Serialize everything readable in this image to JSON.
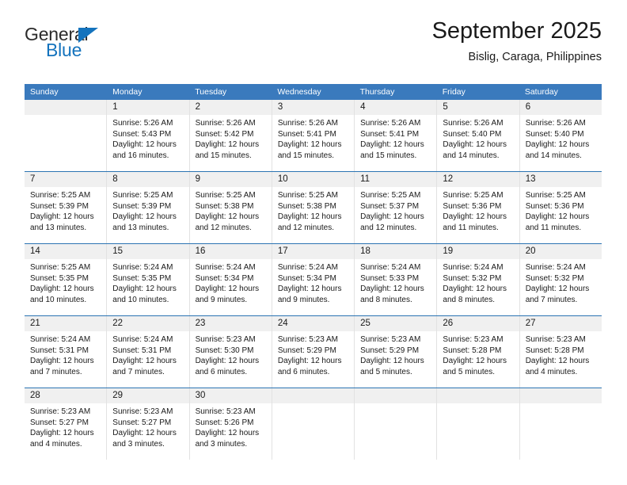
{
  "logo": {
    "text_primary": "General",
    "text_secondary": "Blue",
    "triangle_color": "#1473bd",
    "primary_color": "#2b2b2b",
    "secondary_color": "#1473bd",
    "icon": "triangle-right-icon"
  },
  "header": {
    "title": "September 2025",
    "subtitle": "Bislig, Caraga, Philippines"
  },
  "theme": {
    "header_bg": "#3a7abd",
    "header_text": "#ffffff",
    "row_divider": "#2c74b3",
    "daynum_bg": "#f0f0f0",
    "cell_divider": "#e2e2e2"
  },
  "calendar": {
    "weekdays": [
      "Sunday",
      "Monday",
      "Tuesday",
      "Wednesday",
      "Thursday",
      "Friday",
      "Saturday"
    ],
    "weeks": [
      [
        {
          "day": "",
          "sunrise": "",
          "sunset": "",
          "daylight_line1": "",
          "daylight_line2": ""
        },
        {
          "day": "1",
          "sunrise": "Sunrise: 5:26 AM",
          "sunset": "Sunset: 5:43 PM",
          "daylight_line1": "Daylight: 12 hours",
          "daylight_line2": "and 16 minutes."
        },
        {
          "day": "2",
          "sunrise": "Sunrise: 5:26 AM",
          "sunset": "Sunset: 5:42 PM",
          "daylight_line1": "Daylight: 12 hours",
          "daylight_line2": "and 15 minutes."
        },
        {
          "day": "3",
          "sunrise": "Sunrise: 5:26 AM",
          "sunset": "Sunset: 5:41 PM",
          "daylight_line1": "Daylight: 12 hours",
          "daylight_line2": "and 15 minutes."
        },
        {
          "day": "4",
          "sunrise": "Sunrise: 5:26 AM",
          "sunset": "Sunset: 5:41 PM",
          "daylight_line1": "Daylight: 12 hours",
          "daylight_line2": "and 15 minutes."
        },
        {
          "day": "5",
          "sunrise": "Sunrise: 5:26 AM",
          "sunset": "Sunset: 5:40 PM",
          "daylight_line1": "Daylight: 12 hours",
          "daylight_line2": "and 14 minutes."
        },
        {
          "day": "6",
          "sunrise": "Sunrise: 5:26 AM",
          "sunset": "Sunset: 5:40 PM",
          "daylight_line1": "Daylight: 12 hours",
          "daylight_line2": "and 14 minutes."
        }
      ],
      [
        {
          "day": "7",
          "sunrise": "Sunrise: 5:25 AM",
          "sunset": "Sunset: 5:39 PM",
          "daylight_line1": "Daylight: 12 hours",
          "daylight_line2": "and 13 minutes."
        },
        {
          "day": "8",
          "sunrise": "Sunrise: 5:25 AM",
          "sunset": "Sunset: 5:39 PM",
          "daylight_line1": "Daylight: 12 hours",
          "daylight_line2": "and 13 minutes."
        },
        {
          "day": "9",
          "sunrise": "Sunrise: 5:25 AM",
          "sunset": "Sunset: 5:38 PM",
          "daylight_line1": "Daylight: 12 hours",
          "daylight_line2": "and 12 minutes."
        },
        {
          "day": "10",
          "sunrise": "Sunrise: 5:25 AM",
          "sunset": "Sunset: 5:38 PM",
          "daylight_line1": "Daylight: 12 hours",
          "daylight_line2": "and 12 minutes."
        },
        {
          "day": "11",
          "sunrise": "Sunrise: 5:25 AM",
          "sunset": "Sunset: 5:37 PM",
          "daylight_line1": "Daylight: 12 hours",
          "daylight_line2": "and 12 minutes."
        },
        {
          "day": "12",
          "sunrise": "Sunrise: 5:25 AM",
          "sunset": "Sunset: 5:36 PM",
          "daylight_line1": "Daylight: 12 hours",
          "daylight_line2": "and 11 minutes."
        },
        {
          "day": "13",
          "sunrise": "Sunrise: 5:25 AM",
          "sunset": "Sunset: 5:36 PM",
          "daylight_line1": "Daylight: 12 hours",
          "daylight_line2": "and 11 minutes."
        }
      ],
      [
        {
          "day": "14",
          "sunrise": "Sunrise: 5:25 AM",
          "sunset": "Sunset: 5:35 PM",
          "daylight_line1": "Daylight: 12 hours",
          "daylight_line2": "and 10 minutes."
        },
        {
          "day": "15",
          "sunrise": "Sunrise: 5:24 AM",
          "sunset": "Sunset: 5:35 PM",
          "daylight_line1": "Daylight: 12 hours",
          "daylight_line2": "and 10 minutes."
        },
        {
          "day": "16",
          "sunrise": "Sunrise: 5:24 AM",
          "sunset": "Sunset: 5:34 PM",
          "daylight_line1": "Daylight: 12 hours",
          "daylight_line2": "and 9 minutes."
        },
        {
          "day": "17",
          "sunrise": "Sunrise: 5:24 AM",
          "sunset": "Sunset: 5:34 PM",
          "daylight_line1": "Daylight: 12 hours",
          "daylight_line2": "and 9 minutes."
        },
        {
          "day": "18",
          "sunrise": "Sunrise: 5:24 AM",
          "sunset": "Sunset: 5:33 PM",
          "daylight_line1": "Daylight: 12 hours",
          "daylight_line2": "and 8 minutes."
        },
        {
          "day": "19",
          "sunrise": "Sunrise: 5:24 AM",
          "sunset": "Sunset: 5:32 PM",
          "daylight_line1": "Daylight: 12 hours",
          "daylight_line2": "and 8 minutes."
        },
        {
          "day": "20",
          "sunrise": "Sunrise: 5:24 AM",
          "sunset": "Sunset: 5:32 PM",
          "daylight_line1": "Daylight: 12 hours",
          "daylight_line2": "and 7 minutes."
        }
      ],
      [
        {
          "day": "21",
          "sunrise": "Sunrise: 5:24 AM",
          "sunset": "Sunset: 5:31 PM",
          "daylight_line1": "Daylight: 12 hours",
          "daylight_line2": "and 7 minutes."
        },
        {
          "day": "22",
          "sunrise": "Sunrise: 5:24 AM",
          "sunset": "Sunset: 5:31 PM",
          "daylight_line1": "Daylight: 12 hours",
          "daylight_line2": "and 7 minutes."
        },
        {
          "day": "23",
          "sunrise": "Sunrise: 5:23 AM",
          "sunset": "Sunset: 5:30 PM",
          "daylight_line1": "Daylight: 12 hours",
          "daylight_line2": "and 6 minutes."
        },
        {
          "day": "24",
          "sunrise": "Sunrise: 5:23 AM",
          "sunset": "Sunset: 5:29 PM",
          "daylight_line1": "Daylight: 12 hours",
          "daylight_line2": "and 6 minutes."
        },
        {
          "day": "25",
          "sunrise": "Sunrise: 5:23 AM",
          "sunset": "Sunset: 5:29 PM",
          "daylight_line1": "Daylight: 12 hours",
          "daylight_line2": "and 5 minutes."
        },
        {
          "day": "26",
          "sunrise": "Sunrise: 5:23 AM",
          "sunset": "Sunset: 5:28 PM",
          "daylight_line1": "Daylight: 12 hours",
          "daylight_line2": "and 5 minutes."
        },
        {
          "day": "27",
          "sunrise": "Sunrise: 5:23 AM",
          "sunset": "Sunset: 5:28 PM",
          "daylight_line1": "Daylight: 12 hours",
          "daylight_line2": "and 4 minutes."
        }
      ],
      [
        {
          "day": "28",
          "sunrise": "Sunrise: 5:23 AM",
          "sunset": "Sunset: 5:27 PM",
          "daylight_line1": "Daylight: 12 hours",
          "daylight_line2": "and 4 minutes."
        },
        {
          "day": "29",
          "sunrise": "Sunrise: 5:23 AM",
          "sunset": "Sunset: 5:27 PM",
          "daylight_line1": "Daylight: 12 hours",
          "daylight_line2": "and 3 minutes."
        },
        {
          "day": "30",
          "sunrise": "Sunrise: 5:23 AM",
          "sunset": "Sunset: 5:26 PM",
          "daylight_line1": "Daylight: 12 hours",
          "daylight_line2": "and 3 minutes."
        },
        {
          "day": "",
          "sunrise": "",
          "sunset": "",
          "daylight_line1": "",
          "daylight_line2": ""
        },
        {
          "day": "",
          "sunrise": "",
          "sunset": "",
          "daylight_line1": "",
          "daylight_line2": ""
        },
        {
          "day": "",
          "sunrise": "",
          "sunset": "",
          "daylight_line1": "",
          "daylight_line2": ""
        },
        {
          "day": "",
          "sunrise": "",
          "sunset": "",
          "daylight_line1": "",
          "daylight_line2": ""
        }
      ]
    ]
  }
}
